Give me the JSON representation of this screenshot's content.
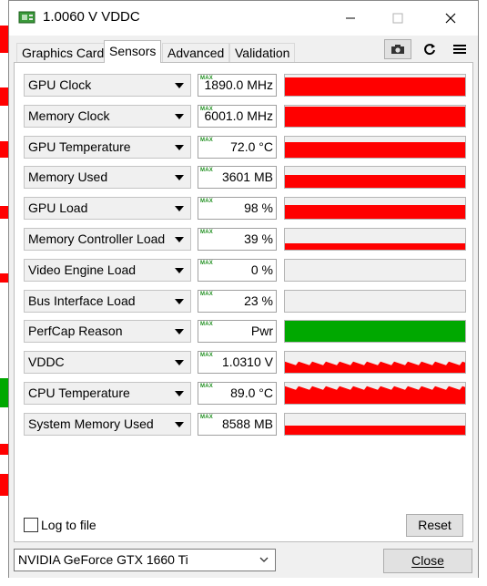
{
  "window": {
    "title": "1.0060 V VDDC",
    "minimize_label": "—",
    "maximize_label": "☐",
    "close_label": "✕"
  },
  "tabs": [
    {
      "label": "Graphics Card",
      "active": false
    },
    {
      "label": "Sensors",
      "active": true
    },
    {
      "label": "Advanced",
      "active": false
    },
    {
      "label": "Validation",
      "active": false
    }
  ],
  "toolbar": {
    "screenshot_icon": "camera-icon",
    "refresh_icon": "refresh-icon",
    "menu_icon": "hamburger-menu-icon"
  },
  "sensors": [
    {
      "name": "GPU Clock",
      "max_label": "MAX",
      "value": "1890.0 MHz",
      "level": 0.85,
      "color": "#ff0000",
      "style": "solid"
    },
    {
      "name": "Memory Clock",
      "max_label": "MAX",
      "value": "6001.0 MHz",
      "level": 0.95,
      "color": "#ff0000",
      "style": "solid"
    },
    {
      "name": "GPU Temperature",
      "max_label": "MAX",
      "value": "72.0 °C",
      "level": 0.72,
      "color": "#ff0000",
      "style": "solid"
    },
    {
      "name": "Memory Used",
      "max_label": "MAX",
      "value": "3601 MB",
      "level": 0.6,
      "color": "#ff0000",
      "style": "solid"
    },
    {
      "name": "GPU Load",
      "max_label": "MAX",
      "value": "98 %",
      "level": 0.65,
      "color": "#ff0000",
      "style": "solid"
    },
    {
      "name": "Memory Controller Load",
      "max_label": "MAX",
      "value": "39 %",
      "level": 0.3,
      "color": "#ff0000",
      "style": "solid"
    },
    {
      "name": "Video Engine Load",
      "max_label": "MAX",
      "value": "0 %",
      "level": 0,
      "color": "#ff0000",
      "style": "solid"
    },
    {
      "name": "Bus Interface Load",
      "max_label": "MAX",
      "value": "23 %",
      "level": 0,
      "color": "#ff0000",
      "style": "solid"
    },
    {
      "name": "PerfCap Reason",
      "max_label": "MAX",
      "value": "Pwr",
      "level": 1.0,
      "color": "#00a800",
      "style": "solid"
    },
    {
      "name": "VDDC",
      "max_label": "MAX",
      "value": "1.0310 V",
      "level": 0.45,
      "color": "#ff0000",
      "style": "jagged"
    },
    {
      "name": "CPU Temperature",
      "max_label": "MAX",
      "value": "89.0 °C",
      "level": 0.75,
      "color": "#ff0000",
      "style": "jagged"
    },
    {
      "name": "System Memory Used",
      "max_label": "MAX",
      "value": "8588 MB",
      "level": 0.45,
      "color": "#ff0000",
      "style": "solid"
    }
  ],
  "footer": {
    "log_to_file_label": "Log to file",
    "log_to_file_checked": false,
    "reset_label": "Reset"
  },
  "bottom": {
    "gpu_selected": "NVIDIA GeForce GTX 1660 Ti",
    "close_label": "Close"
  }
}
